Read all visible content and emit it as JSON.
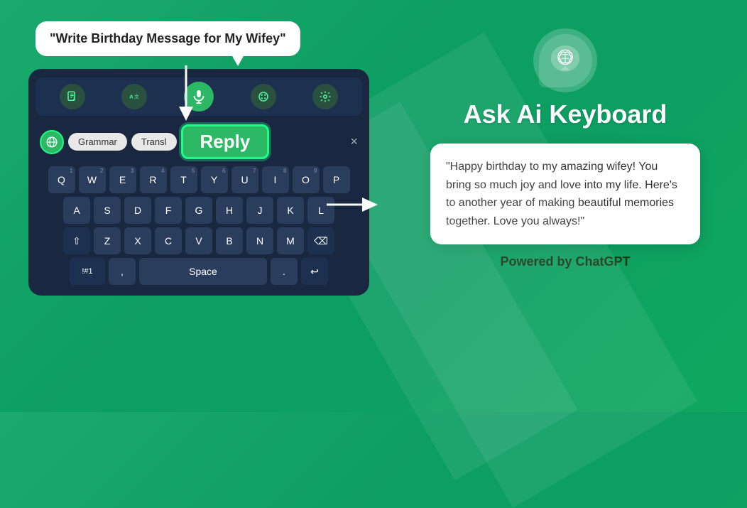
{
  "background": {
    "gradient_start": "#1aaa6e",
    "gradient_end": "#0fa860"
  },
  "left": {
    "speech_bubble_text": "\"Write Birthday Message for My Wifey\"",
    "keyboard": {
      "toolbar_icons": [
        "dictionary-icon",
        "translate-icon",
        "mic-icon",
        "palette-icon",
        "settings-icon"
      ],
      "tagbar": {
        "globe_label": "globe",
        "tags": [
          "Grammar",
          "Transl"
        ],
        "reply_button_label": "Reply",
        "close_label": "×"
      },
      "rows": [
        {
          "keys": [
            {
              "label": "Q",
              "num": "1"
            },
            {
              "label": "W",
              "num": "2"
            },
            {
              "label": "E",
              "num": "3"
            },
            {
              "label": "R",
              "num": "4"
            },
            {
              "label": "T",
              "num": "5"
            },
            {
              "label": "Y",
              "num": "6"
            },
            {
              "label": "U",
              "num": "7"
            },
            {
              "label": "I",
              "num": "8"
            },
            {
              "label": "O",
              "num": "9"
            },
            {
              "label": "P",
              "num": ""
            }
          ]
        },
        {
          "keys": [
            {
              "label": "A"
            },
            {
              "label": "S"
            },
            {
              "label": "D"
            },
            {
              "label": "F"
            },
            {
              "label": "G"
            },
            {
              "label": "H"
            },
            {
              "label": "J"
            },
            {
              "label": "K"
            },
            {
              "label": "L"
            }
          ]
        },
        {
          "keys": [
            {
              "label": "⇧",
              "type": "shift"
            },
            {
              "label": "Z"
            },
            {
              "label": "X"
            },
            {
              "label": "C"
            },
            {
              "label": "V"
            },
            {
              "label": "B"
            },
            {
              "label": "N"
            },
            {
              "label": "M"
            },
            {
              "label": "⌫",
              "type": "action"
            }
          ]
        },
        {
          "keys": [
            {
              "label": "!#1",
              "type": "action"
            },
            {
              "label": ","
            },
            {
              "label": "Space",
              "type": "space"
            },
            {
              "label": ".",
              "type": "action"
            },
            {
              "label": "↩",
              "type": "action"
            }
          ]
        }
      ]
    }
  },
  "right": {
    "app_icon_alt": "AI Brain Icon",
    "app_title": "Ask Ai Keyboard",
    "response_card": {
      "text": "\"Happy birthday to my amazing wifey! You bring so much joy and love into my life. Here's to another year of making beautiful memories together. Love you always!\""
    },
    "powered_by": "Powered by ChatGPT"
  }
}
